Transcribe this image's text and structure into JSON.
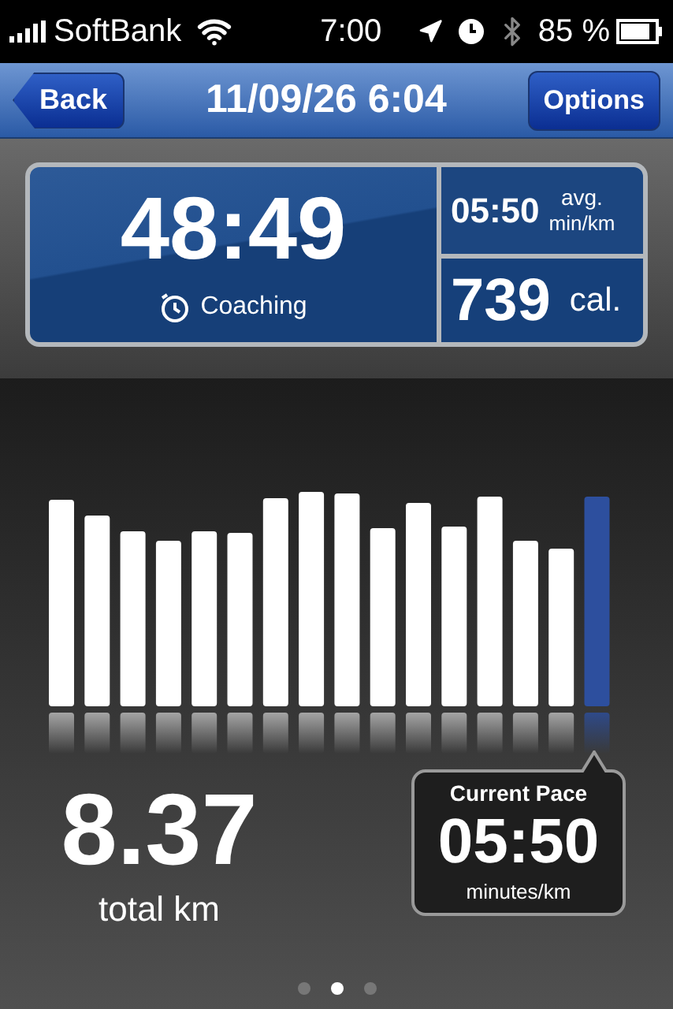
{
  "status_bar": {
    "carrier": "SoftBank",
    "time": "7:00",
    "battery": "85 %"
  },
  "nav_bar": {
    "back": "Back",
    "title": "11/09/26 6:04",
    "options": "Options"
  },
  "stats": {
    "duration": "48:49",
    "coaching": "Coaching",
    "avg_pace": "05:50",
    "avg_label": "avg.",
    "avg_unit": "min/km",
    "calories": "739",
    "calories_unit": "cal."
  },
  "distance": {
    "value": "8.37",
    "unit": "total km"
  },
  "current_pace": {
    "title": "Current Pace",
    "value": "05:50",
    "unit": "minutes/km"
  },
  "page_dots": [
    {
      "selected": false
    },
    {
      "selected": true
    },
    {
      "selected": false
    }
  ]
}
